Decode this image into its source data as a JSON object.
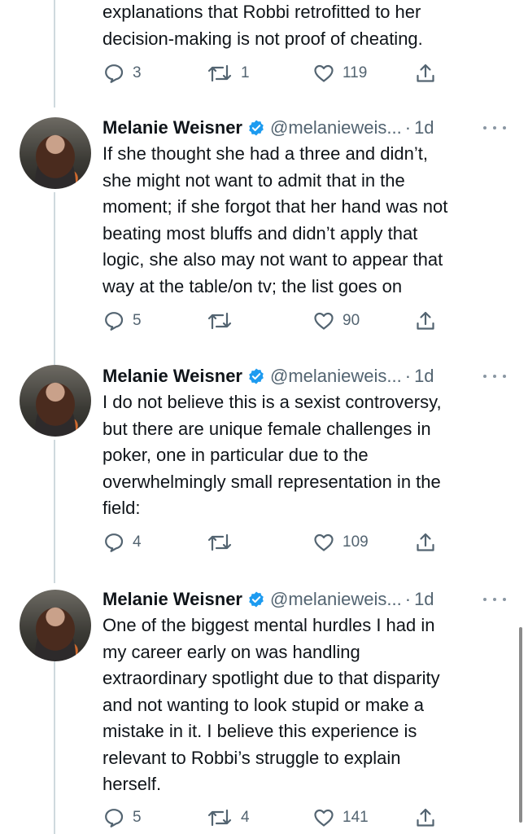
{
  "tweets": [
    {
      "body": "explanations that Robbi retrofitted to her\ndecision-making is not proof of cheating.",
      "actions": {
        "replies": "3",
        "retweets": "1",
        "likes": "119"
      }
    },
    {
      "author": {
        "name": "Melanie Weisner",
        "handle": "@melanieweis...",
        "time": "1d"
      },
      "body": "If she thought she had a three and didn’t,\nshe might not want to admit that in the\nmoment; if she forgot that her hand was not\nbeating most bluffs and didn’t apply that\nlogic, she also may not want to appear that\nway at the table/on tv; the list goes on",
      "actions": {
        "replies": "5",
        "retweets": "",
        "likes": "90"
      }
    },
    {
      "author": {
        "name": "Melanie Weisner",
        "handle": "@melanieweis...",
        "time": "1d"
      },
      "body": "I do not believe this is a sexist controversy,\nbut there are unique female challenges in\npoker, one in particular due to the\noverwhelmingly small representation in the\nfield:",
      "actions": {
        "replies": "4",
        "retweets": "",
        "likes": "109"
      }
    },
    {
      "author": {
        "name": "Melanie Weisner",
        "handle": "@melanieweis...",
        "time": "1d"
      },
      "body": "One of the biggest mental hurdles I had in\nmy career early on was handling\nextraordinary spotlight due to that disparity\nand not wanting to look stupid or make a\nmistake in it. I believe this experience is\nrelevant to Robbi’s struggle to explain\nherself.",
      "actions": {
        "replies": "5",
        "retweets": "4",
        "likes": "141"
      }
    }
  ],
  "separator": "·",
  "icons": {
    "reply": "reply-icon",
    "retweet": "retweet-icon",
    "like": "like-icon",
    "share": "share-icon",
    "verified": "verified-badge-icon",
    "more": "more-icon"
  },
  "colors": {
    "text": "#0f1419",
    "secondary": "#536471",
    "verified": "#1d9bf0",
    "thread_line": "#cfd9de"
  }
}
